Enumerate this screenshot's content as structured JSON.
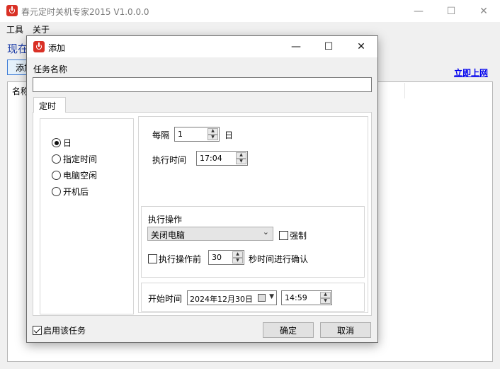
{
  "main_window": {
    "title": "春元定时关机专家2015 V1.0.0.0",
    "menu": [
      "工具",
      "关于"
    ],
    "heading_partial": "现在",
    "add_button_partial": "添加",
    "link": "立即上网",
    "list_column_partial": "名称"
  },
  "dialog": {
    "title": "添加",
    "task_name_label": "任务名称",
    "task_name_value": "",
    "tab_label": "定时",
    "frequency_options": [
      "日",
      "指定时间",
      "电脑空闲",
      "开机后"
    ],
    "frequency_selected": "日",
    "interval_label": "每隔",
    "interval_value": "1",
    "interval_unit": "日",
    "exec_time_label": "执行时间",
    "exec_time_value": "17:04",
    "action_group_label": "执行操作",
    "action_value": "关闭电脑",
    "force_label": "强制",
    "force_checked": false,
    "confirm_before_label": "执行操作前",
    "confirm_before_checked": false,
    "confirm_seconds": "30",
    "confirm_suffix": "秒时间进行确认",
    "start_time_label": "开始时间",
    "start_date_value": "2024年12月30日",
    "start_time_value": "14:59",
    "enable_label": "启用该任务",
    "enable_checked": true,
    "ok_label": "确定",
    "cancel_label": "取消"
  },
  "colors": {
    "app_icon": "#d93025",
    "heading": "#1f3fa8",
    "link": "#0000ee",
    "focus_border": "#3d7bd6"
  }
}
